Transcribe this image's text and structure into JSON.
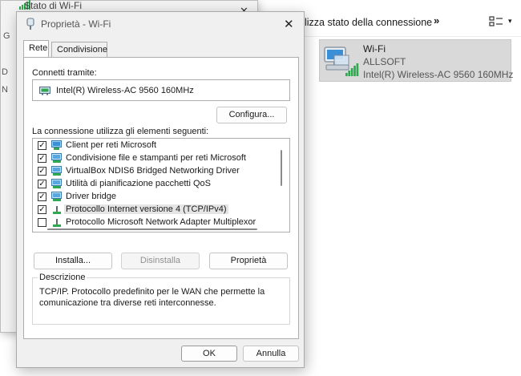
{
  "background": {
    "toolbar_label": "lizza stato della connessione",
    "chevrons": "»",
    "view_caret": "▾",
    "tile": {
      "name": "Wi-Fi",
      "network": "ALLSOFT",
      "adapter": "Intel(R) Wireless-AC 9560 160MHz"
    }
  },
  "status_window": {
    "title": "Stato di Wi-Fi",
    "close": "✕",
    "left_fragments": [
      "G",
      "D",
      "N"
    ]
  },
  "dialog": {
    "title": "Proprietà - Wi-Fi",
    "close": "✕",
    "tabs": [
      "Rete",
      "Condivisione"
    ],
    "connect_label": "Connetti tramite:",
    "adapter": "Intel(R) Wireless-AC 9560 160MHz",
    "configure_button": "Configura...",
    "items_label": "La connessione utilizza gli elementi seguenti:",
    "items": [
      {
        "label": "Client per reti Microsoft",
        "checked": true,
        "icon": "network-client-icon"
      },
      {
        "label": "Condivisione file e stampanti per reti Microsoft",
        "checked": true,
        "icon": "network-service-icon"
      },
      {
        "label": "VirtualBox NDIS6 Bridged Networking Driver",
        "checked": true,
        "icon": "network-service-icon"
      },
      {
        "label": "Utilità di pianificazione pacchetti QoS",
        "checked": true,
        "icon": "network-service-icon"
      },
      {
        "label": "Driver bridge",
        "checked": true,
        "icon": "network-service-icon"
      },
      {
        "label": "Protocollo Internet versione 4 (TCP/IPv4)",
        "checked": true,
        "icon": "protocol-icon",
        "selected": true
      },
      {
        "label": "Protocollo Microsoft Network Adapter Multiplexor",
        "checked": false,
        "icon": "protocol-icon"
      }
    ],
    "install_button": "Installa...",
    "uninstall_button": "Disinstalla",
    "properties_button": "Proprietà",
    "description_legend": "Descrizione",
    "description_text": "TCP/IP. Protocollo predefinito per le WAN che permette la comunicazione tra diverse reti interconnesse.",
    "ok_button": "OK",
    "cancel_button": "Annulla"
  },
  "colors": {
    "dialog_bg": "#f0f0f0",
    "panel_bg": "#ffffff",
    "tile_bg": "#d9d9d9",
    "signal_green": "#2fa84f",
    "monitor_blue": "#3b8fd6"
  }
}
